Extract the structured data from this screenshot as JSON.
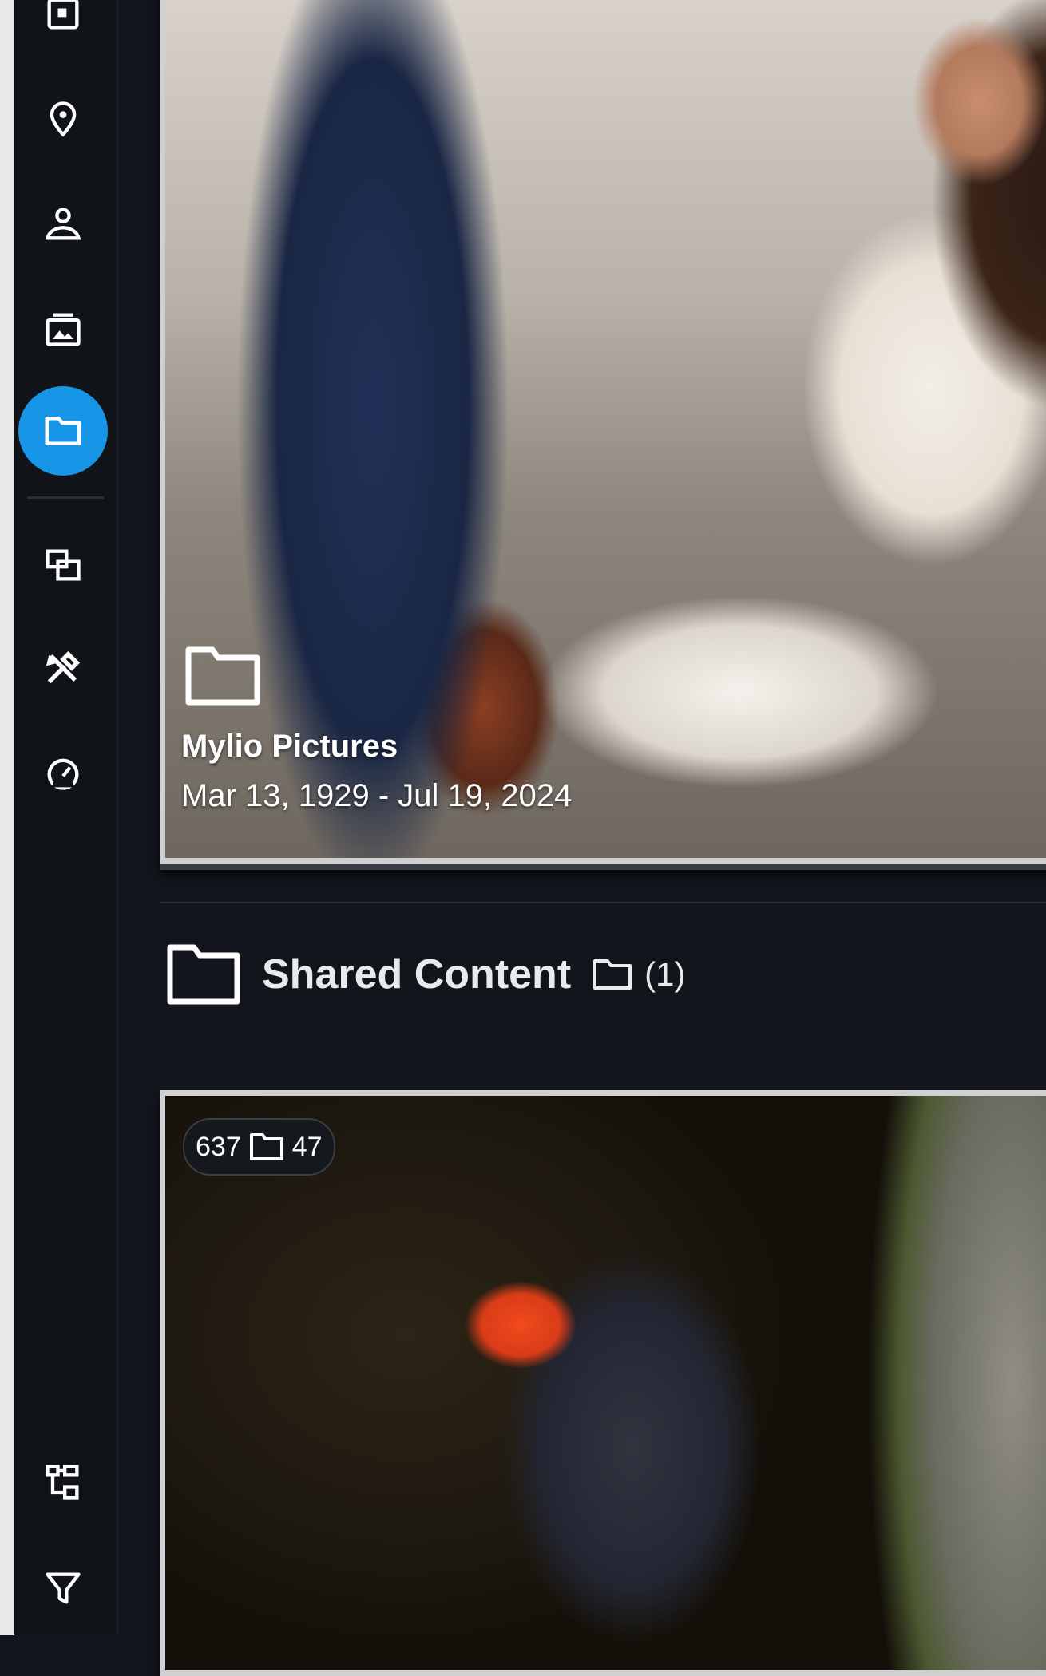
{
  "sidebar": {
    "items": [
      {
        "name": "calendar-icon"
      },
      {
        "name": "location-pin-icon"
      },
      {
        "name": "person-icon"
      },
      {
        "name": "album-icon"
      },
      {
        "name": "folder-icon",
        "active": true
      },
      {
        "name": "duplicate-pages-icon"
      },
      {
        "name": "tools-icon"
      },
      {
        "name": "speedometer-icon"
      },
      {
        "name": "hierarchy-icon"
      },
      {
        "name": "filter-icon"
      }
    ],
    "accent": "#1796e8"
  },
  "folders": [
    {
      "title": "Mylio Pictures",
      "dates": "Mar 13, 1929 - Jul 19, 2024"
    }
  ],
  "shared_section": {
    "title": "Shared Content",
    "count": "(1)",
    "card": {
      "badge_photos": "637",
      "badge_folders": "47"
    }
  }
}
